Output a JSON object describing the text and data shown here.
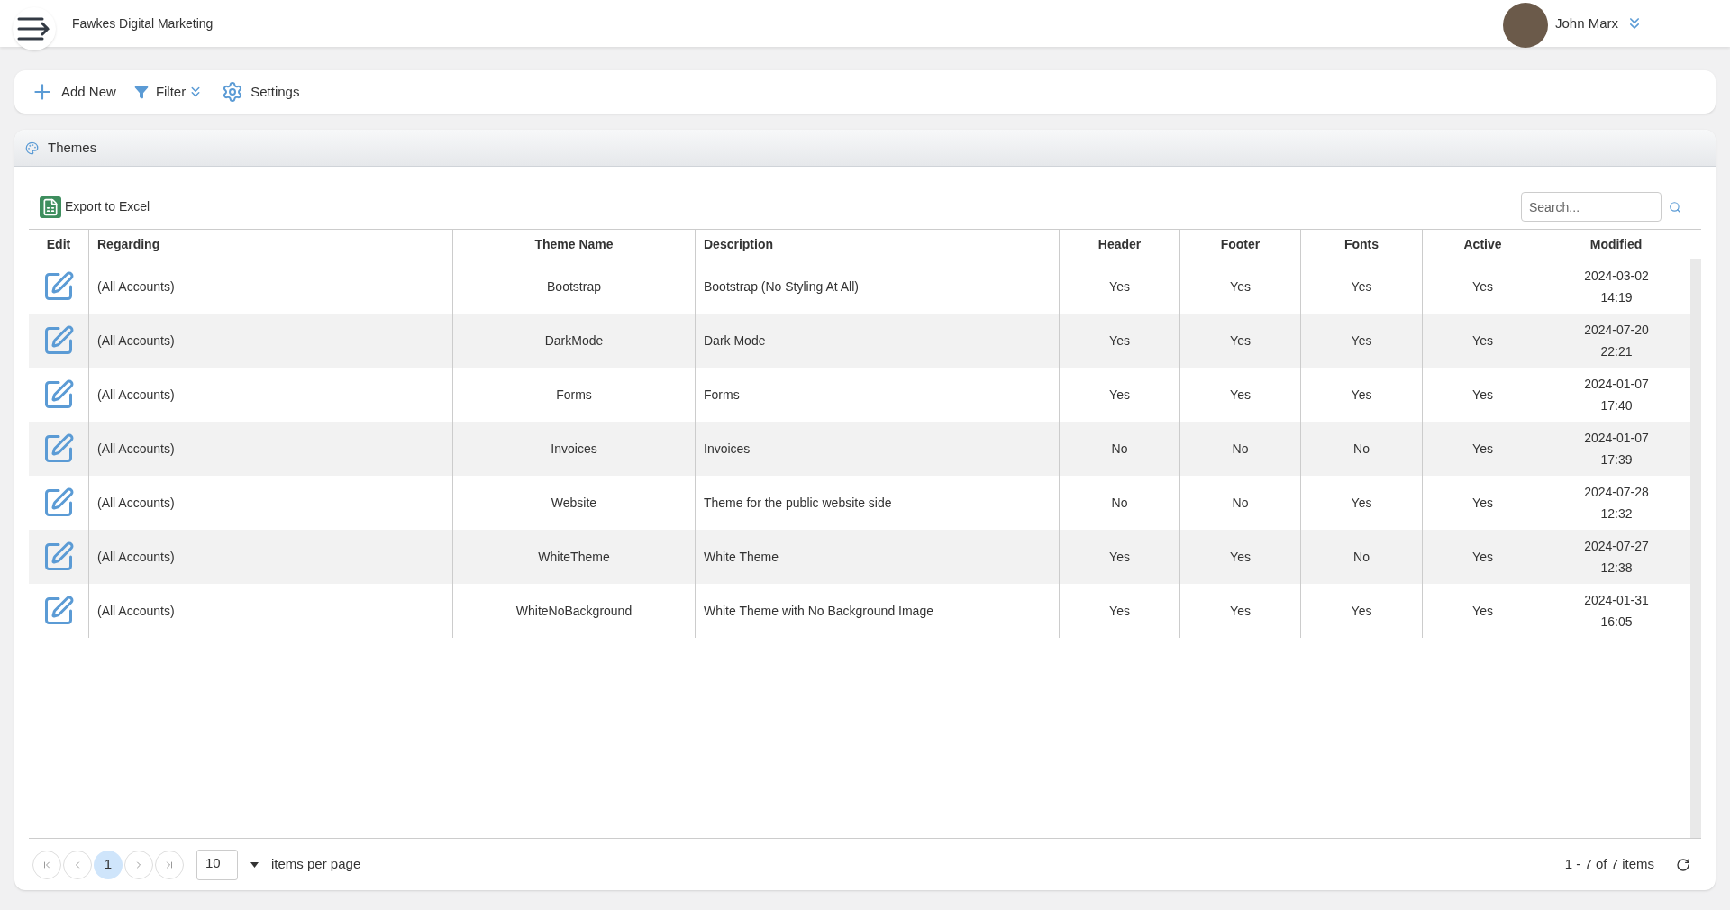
{
  "header": {
    "company": "Fawkes Digital Marketing",
    "user": "John Marx"
  },
  "toolbar": [
    "Add New",
    "Filter",
    "Settings"
  ],
  "panel": {
    "title": "Themes",
    "export": "Export to Excel",
    "search_placeholder": "Search..."
  },
  "table": {
    "columns": [
      "Edit",
      "Regarding",
      "Theme Name",
      "Description",
      "Header",
      "Footer",
      "Fonts",
      "Active",
      "Modified"
    ],
    "rows": [
      {
        "regarding": "(All Accounts)",
        "theme_name": "Bootstrap",
        "description": "Bootstrap (No Styling At All)",
        "header": "Yes",
        "footer": "Yes",
        "fonts": "Yes",
        "active": "Yes",
        "modified": [
          "2024-03-02",
          "14:19"
        ]
      },
      {
        "regarding": "(All Accounts)",
        "theme_name": "DarkMode",
        "description": "Dark Mode",
        "header": "Yes",
        "footer": "Yes",
        "fonts": "Yes",
        "active": "Yes",
        "modified": [
          "2024-07-20",
          "22:21"
        ]
      },
      {
        "regarding": "(All Accounts)",
        "theme_name": "Forms",
        "description": "Forms",
        "header": "Yes",
        "footer": "Yes",
        "fonts": "Yes",
        "active": "Yes",
        "modified": [
          "2024-01-07",
          "17:40"
        ]
      },
      {
        "regarding": "(All Accounts)",
        "theme_name": "Invoices",
        "description": "Invoices",
        "header": "No",
        "footer": "No",
        "fonts": "No",
        "active": "Yes",
        "modified": [
          "2024-01-07",
          "17:39"
        ]
      },
      {
        "regarding": "(All Accounts)",
        "theme_name": "Website",
        "description": "Theme for the public website side",
        "header": "No",
        "footer": "No",
        "fonts": "Yes",
        "active": "Yes",
        "modified": [
          "2024-07-28",
          "12:32"
        ]
      },
      {
        "regarding": "(All Accounts)",
        "theme_name": "WhiteTheme",
        "description": "White Theme",
        "header": "Yes",
        "footer": "Yes",
        "fonts": "No",
        "active": "Yes",
        "modified": [
          "2024-07-27",
          "12:38"
        ]
      },
      {
        "regarding": "(All Accounts)",
        "theme_name": "WhiteNoBackground",
        "description": "White Theme with No Background Image",
        "header": "Yes",
        "footer": "Yes",
        "fonts": "Yes",
        "active": "Yes",
        "modified": [
          "2024-01-31",
          "16:05"
        ]
      }
    ]
  },
  "pager": {
    "pages": [
      {
        "label": "1",
        "selected": true
      }
    ],
    "page_size": "10",
    "per_page_label": "items per page",
    "summary": "1 - 7 of 7 items"
  }
}
